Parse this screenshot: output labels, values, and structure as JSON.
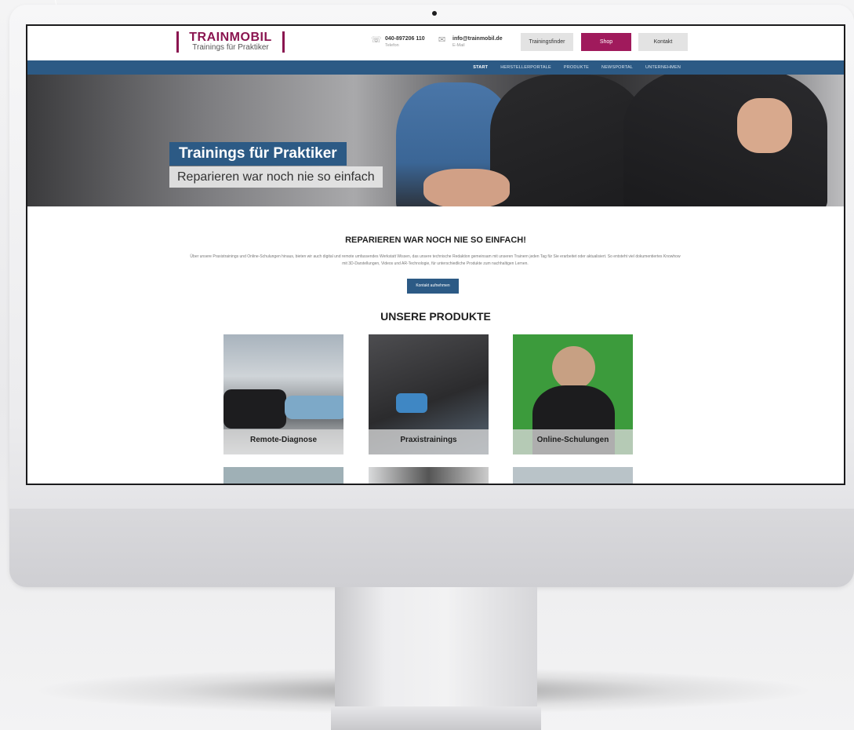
{
  "header": {
    "logo": {
      "main": "TRAINMOBIL",
      "sub": "Trainings für Praktiker"
    },
    "phone": {
      "value": "040-897206 110",
      "label": "Telefon",
      "icon": "phone-icon"
    },
    "email": {
      "value": "info@trainmobil.de",
      "label": "E-Mail",
      "icon": "mail-icon"
    },
    "buttons": {
      "finder": "Trainingsfinder",
      "shop": "Shop",
      "contact": "Kontakt"
    }
  },
  "nav": {
    "items": [
      "START",
      "HERSTELLERPORTALE",
      "PRODUKTE",
      "NEWSPORTAL",
      "UNTERNEHMEN"
    ],
    "active": "START"
  },
  "hero": {
    "title": "Trainings für Praktiker",
    "subtitle": "Reparieren war noch nie so einfach"
  },
  "intro": {
    "heading": "REPARIEREN WAR NOCH NIE SO EINFACH!",
    "text": "Über unsere Praxistrainings und Online-Schulungen hinaus, bieten wir auch digital und remote umfassendes Werkstatt Wissen, das unsere technische Redaktion gemeinsam mit unseren Trainern jeden Tag für Sie erarbeitet oder aktualisiert. So entsteht viel dokumentiertes Knowhow mit 3D-Darstellungen, Videos und AR-Technologie, für unterschiedliche Produkte zum nachhaltigen Lernen.",
    "cta": "Kontakt aufnehmen"
  },
  "products": {
    "heading": "UNSERE PRODUKTE",
    "cards": [
      {
        "label": "Remote-Diagnose"
      },
      {
        "label": "Praxistrainings"
      },
      {
        "label": "Online-Schulungen"
      }
    ]
  },
  "colors": {
    "brand": "#8a1550",
    "navy": "#2c5a85",
    "shop": "#a01a5c"
  }
}
